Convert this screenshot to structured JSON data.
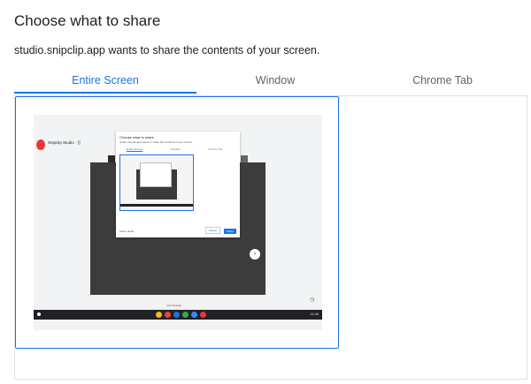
{
  "dialog": {
    "title": "Choose what to share",
    "subtitle": "studio.snipclip.app wants to share the contents of your screen."
  },
  "tabs": [
    {
      "label": "Entire Screen",
      "active": true
    },
    {
      "label": "Window",
      "active": false
    },
    {
      "label": "Chrome Tab",
      "active": false
    }
  ],
  "colors": {
    "accent": "#1a73e8",
    "text": "#202124",
    "muted": "#5f6368",
    "border": "#e0e0e0"
  },
  "preview": {
    "app_name": "Snipclip Studio",
    "mini_dialog": {
      "title": "Choose what to share",
      "subtitle": "studio.snipclip.app wants to share the contents of your screen.",
      "tabs": [
        "Entire Screen",
        "Window",
        "Chrome Tab"
      ],
      "footer": "Share audio",
      "cancel": "Cancel",
      "share": "Share"
    },
    "visit_text": "Visit Snipclip",
    "next_icon": "chevron-right-icon",
    "shelf_time": "11:46"
  }
}
